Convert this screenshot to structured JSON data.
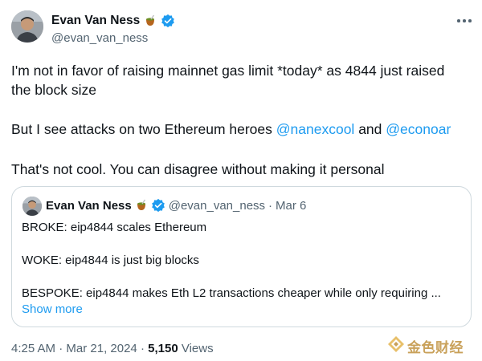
{
  "tweet": {
    "author_name": "Evan Van Ness",
    "author_handle": "@evan_van_ness",
    "text": {
      "line1": "I'm not in favor of raising mainnet gas limit *today* as 4844 just raised",
      "line2": "the block size",
      "line3_prefix": "But I see attacks on two Ethereum heroes ",
      "mention1": "@nanexcool",
      "line3_mid": " and ",
      "mention2": "@econoar",
      "line4": "That's not cool.  You can disagree without making it personal"
    },
    "time": "4:25 AM",
    "separator": "·",
    "date": "Mar 21, 2024",
    "views_count": "5,150",
    "views_label": "Views"
  },
  "quote": {
    "author_name": "Evan Van Ness",
    "author_handle": "@evan_van_ness",
    "separator": "·",
    "date": "Mar 6",
    "line1": "BROKE: eip4844 scales Ethereum",
    "line2": "WOKE: eip4844 is just big blocks",
    "line3": "BESPOKE: eip4844 makes Eth L2 transactions cheaper while only requiring ...",
    "show_more": "Show more"
  },
  "watermark": {
    "text": "金色财经"
  },
  "colors": {
    "accent": "#1d9bf0",
    "text": "#0f1419",
    "muted": "#536471",
    "border": "#cfd9de",
    "watermark": "#c9a15a"
  },
  "icons": {
    "verified": "verified-badge-icon",
    "mate": "mate-cup-icon",
    "more": "more-options-icon",
    "watermark_logo": "jinse-logo-icon"
  }
}
